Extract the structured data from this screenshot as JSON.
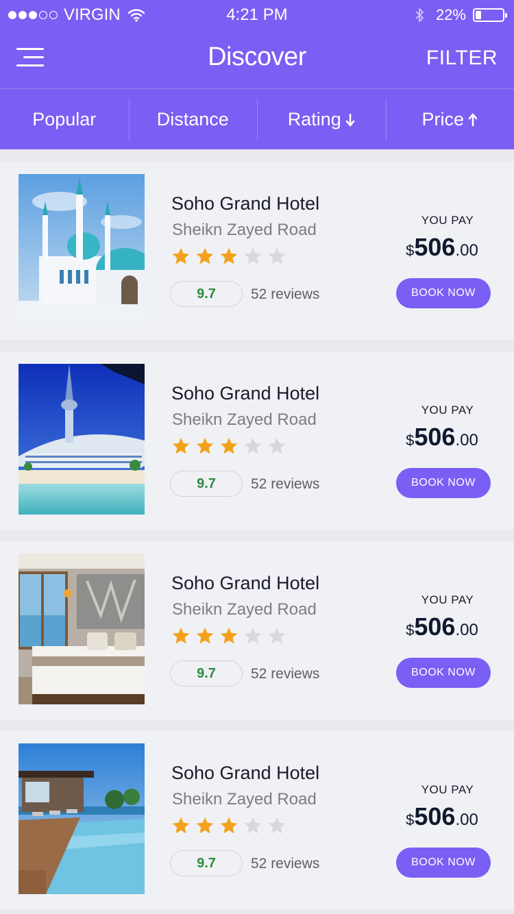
{
  "status_bar": {
    "carrier": "VIRGIN",
    "time": "4:21 PM",
    "battery": "22%",
    "battery_level": 0.22
  },
  "nav": {
    "title": "Discover",
    "filter_label": "FILTER"
  },
  "sort_tabs": [
    {
      "label": "Popular",
      "arrow": ""
    },
    {
      "label": "Distance",
      "arrow": ""
    },
    {
      "label": "Rating",
      "arrow": "down"
    },
    {
      "label": "Price",
      "arrow": "up"
    }
  ],
  "colors": {
    "brand": "#7b5ef3",
    "star_on": "#f4a21b",
    "star_off": "#d8d8dc",
    "rating_text": "#2e8b3e"
  },
  "hotels": [
    {
      "name": "Soho Grand Hotel",
      "address": "Sheikn Zayed Road",
      "stars": 3,
      "max_stars": 5,
      "rating": "9.7",
      "reviews": "52 reviews",
      "pay_label": "YOU PAY",
      "currency": "$",
      "price_int": "506",
      "price_dec": ".00",
      "book_label": "BOOK NOW",
      "image": "mosque"
    },
    {
      "name": "Soho Grand Hotel",
      "address": "Sheikn Zayed Road",
      "stars": 3,
      "max_stars": 5,
      "rating": "9.7",
      "reviews": "52 reviews",
      "pay_label": "YOU PAY",
      "currency": "$",
      "price_int": "506",
      "price_dec": ".00",
      "book_label": "BOOK NOW",
      "image": "beach-resort"
    },
    {
      "name": "Soho Grand Hotel",
      "address": "Sheikn Zayed Road",
      "stars": 3,
      "max_stars": 5,
      "rating": "9.7",
      "reviews": "52 reviews",
      "pay_label": "YOU PAY",
      "currency": "$",
      "price_int": "506",
      "price_dec": ".00",
      "book_label": "BOOK NOW",
      "image": "hotel-bedroom"
    },
    {
      "name": "Soho Grand Hotel",
      "address": "Sheikn Zayed Road",
      "stars": 3,
      "max_stars": 5,
      "rating": "9.7",
      "reviews": "52 reviews",
      "pay_label": "YOU PAY",
      "currency": "$",
      "price_int": "506",
      "price_dec": ".00",
      "book_label": "BOOK NOW",
      "image": "infinity-pool"
    }
  ]
}
